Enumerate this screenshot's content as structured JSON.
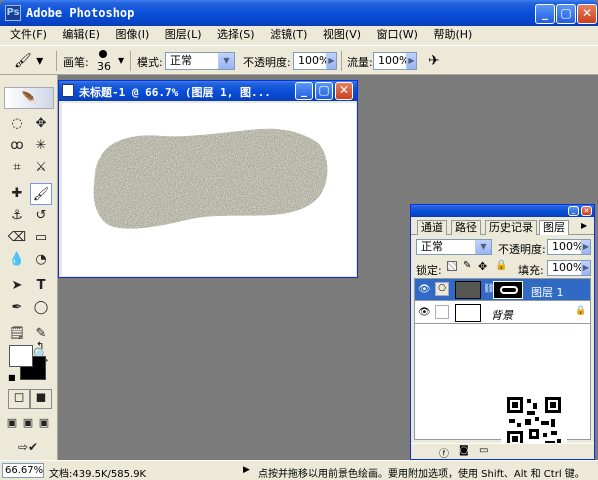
{
  "app": {
    "title": "Adobe Photoshop"
  },
  "menu": [
    "文件(F)",
    "编辑(E)",
    "图像(I)",
    "图层(L)",
    "选择(S)",
    "滤镜(T)",
    "视图(V)",
    "窗口(W)",
    "帮助(H)"
  ],
  "options": {
    "brush_label": "画笔:",
    "brush_size": "36",
    "mode_label": "模式:",
    "mode_value": "正常",
    "opacity_label": "不透明度:",
    "opacity_value": "100%",
    "flow_label": "流量:",
    "flow_value": "100%"
  },
  "document": {
    "title": "未标题-1 @ 66.7% (图层 1, 图..."
  },
  "layers_panel": {
    "tabs": [
      "通道",
      "路径",
      "历史记录",
      "图层"
    ],
    "blend_mode": "正常",
    "opacity_label": "不透明度:",
    "opacity_value": "100%",
    "lock_label": "锁定:",
    "fill_label": "填充:",
    "fill_value": "100%",
    "layers": [
      {
        "name": "图层 1",
        "selected": true
      },
      {
        "name": "背景",
        "selected": false
      }
    ]
  },
  "status": {
    "zoom": "66.67%",
    "doc_info": "文档:439.5K/585.9K",
    "hint": "点按并拖移以用前景色绘画。要用附加选项，使用 Shift、Alt 和 Ctrl 键。"
  },
  "colors": {
    "titlebar": "#0a4fd8",
    "workspace": "#7b7b7b",
    "chrome": "#ece9d8",
    "selection": "#316ac5"
  }
}
